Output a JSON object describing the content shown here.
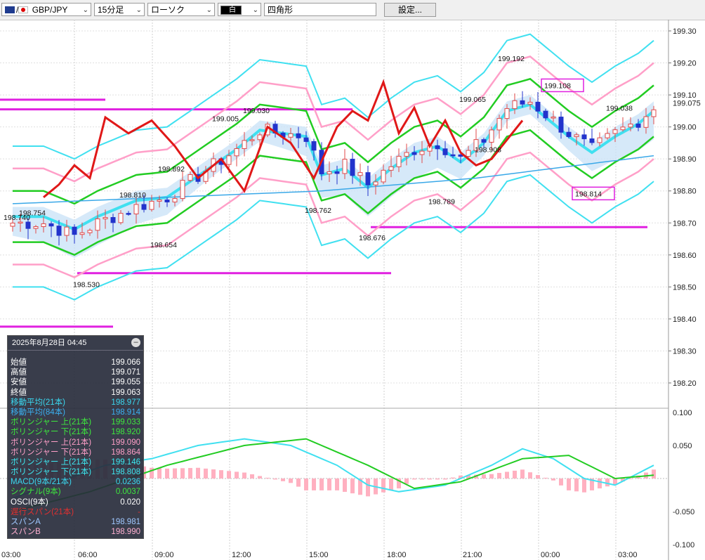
{
  "toolbar": {
    "pair": "GBP/JPY",
    "timeframe": "15分足",
    "chart_type": "ローソク",
    "draw_color": "白",
    "shape": "四角形",
    "settings": "設定..."
  },
  "info": {
    "datetime": "2025年8月28日  04:45",
    "rows": [
      {
        "label": "始値",
        "value": "199.066",
        "color": "#ffffff"
      },
      {
        "label": "高値",
        "value": "199.071",
        "color": "#ffffff"
      },
      {
        "label": "安値",
        "value": "199.055",
        "color": "#ffffff"
      },
      {
        "label": "終値",
        "value": "199.063",
        "color": "#ffffff"
      },
      {
        "label": "移動平均(21本)",
        "value": "198.977",
        "color": "#3ad8f0"
      },
      {
        "label": "移動平均(84本)",
        "value": "198.914",
        "color": "#3ab0f0"
      },
      {
        "label": "ボリンジャー 上(21本)",
        "value": "199.033",
        "color": "#3ee83e"
      },
      {
        "label": "ボリンジャー 下(21本)",
        "value": "198.920",
        "color": "#3ee83e"
      },
      {
        "label": "ボリンジャー 上(21本)",
        "value": "199.090",
        "color": "#ff9fc8"
      },
      {
        "label": "ボリンジャー 下(21本)",
        "value": "198.864",
        "color": "#ff9fc8"
      },
      {
        "label": "ボリンジャー 上(21本)",
        "value": "199.146",
        "color": "#3ee8f0"
      },
      {
        "label": "ボリンジャー 下(21本)",
        "value": "198.808",
        "color": "#3ee8f0"
      },
      {
        "label": "MACD(9本/21本)",
        "value": "0.0236",
        "color": "#3ad8f0"
      },
      {
        "label": "シグナル(9本)",
        "value": "0.0037",
        "color": "#3ee83e"
      },
      {
        "label": "OSCI(9本)",
        "value": "0.020",
        "color": "#ffffff"
      },
      {
        "label": "遅行スパン(21本)",
        "value": "-",
        "color": "#e03030"
      },
      {
        "label": "スパンA",
        "value": "198.981",
        "color": "#9fc8ff"
      },
      {
        "label": "スパンB",
        "value": "198.990",
        "color": "#ffb0d0"
      }
    ]
  },
  "chart_data": {
    "type": "candlestick",
    "x_labels": [
      "03:00",
      "06:00",
      "09:00",
      "12:00",
      "15:00",
      "18:00",
      "21:00",
      "00:00",
      "03:00"
    ],
    "price_axis": [
      "199.30",
      "199.20",
      "199.10",
      "199.00",
      "198.90",
      "198.80",
      "198.70",
      "198.60",
      "198.50",
      "198.40",
      "198.30",
      "198.20"
    ],
    "price_range": [
      198.155,
      199.3
    ],
    "macd_axis": [
      "0.100",
      "0.050",
      "-0.050",
      "-0.100"
    ],
    "macd_range": [
      -0.1,
      0.1
    ],
    "current_price": "199.075",
    "annotations": [
      {
        "text": "198.740",
        "price": 198.74,
        "slot": 1
      },
      {
        "text": "198.754",
        "price": 198.754,
        "slot": 3
      },
      {
        "text": "198.530",
        "price": 198.53,
        "slot": 10
      },
      {
        "text": "198.810",
        "price": 198.81,
        "slot": 16
      },
      {
        "text": "198.654",
        "price": 198.654,
        "slot": 20
      },
      {
        "text": "198.892",
        "price": 198.892,
        "slot": 21
      },
      {
        "text": "199.005",
        "price": 199.005,
        "slot": 28
      },
      {
        "text": "199.030",
        "price": 199.03,
        "slot": 32
      },
      {
        "text": "198.762",
        "price": 198.762,
        "slot": 40
      },
      {
        "text": "198.676",
        "price": 198.676,
        "slot": 47
      },
      {
        "text": "198.789",
        "price": 198.789,
        "slot": 56
      },
      {
        "text": "199.065",
        "price": 199.065,
        "slot": 60
      },
      {
        "text": "198.908",
        "price": 198.908,
        "slot": 62
      },
      {
        "text": "199.192",
        "price": 199.192,
        "slot": 65
      },
      {
        "text": "199.108",
        "price": 199.108,
        "slot": 71,
        "boxed": true
      },
      {
        "text": "198.814",
        "price": 198.814,
        "slot": 75,
        "boxed": true
      },
      {
        "text": "199.038",
        "price": 199.038,
        "slot": 79
      }
    ],
    "horizontal_lines": [
      {
        "price": 199.085,
        "from": 0,
        "to": 12
      },
      {
        "price": 199.055,
        "from": 0,
        "to": 44
      },
      {
        "price": 198.687,
        "from": 48,
        "to": 83
      },
      {
        "price": 198.543,
        "from": 10,
        "to": 49
      },
      {
        "price": 198.376,
        "from": 0,
        "to": 13
      }
    ],
    "colors": {
      "up": "#e04a4a",
      "down": "#2233cc",
      "ma21": "#40e0f0",
      "ma84": "#3aa8e8",
      "bb1": "#22cc22",
      "bb2": "#ff9fc8",
      "bb3": "#40e0f0",
      "lagging": "#e01818",
      "cloud": "#cce4f8",
      "cloud_pink": "#ffd2e4",
      "hline": "#e020e0",
      "macd": "#40e0f0",
      "signal": "#22cc22",
      "hist": "#ffb0c0"
    }
  }
}
